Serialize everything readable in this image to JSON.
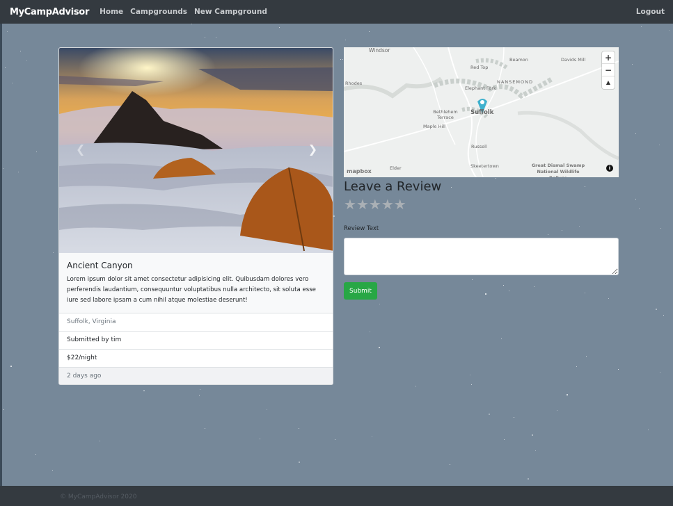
{
  "navbar": {
    "brand": "MyCampAdvisor",
    "links": [
      "Home",
      "Campgrounds",
      "New Campground"
    ],
    "logout": "Logout"
  },
  "campground": {
    "title": "Ancient Canyon",
    "description": "Lorem ipsum dolor sit amet consectetur adipisicing elit. Quibusdam dolores vero perferendis laudantium, consequuntur voluptatibus nulla architecto, sit soluta esse iure sed labore ipsam a cum nihil atque molestiae deserunt!",
    "location": "Suffolk, Virginia",
    "submitted_by": "Submitted by tim",
    "price": "$22/night",
    "posted": "2 days ago"
  },
  "carousel": {
    "prev_icon": "chevron-left-icon",
    "next_icon": "chevron-right-icon"
  },
  "map": {
    "labels": [
      "Windsor",
      "Beamon",
      "Davids Mill",
      "Red Top",
      "NANSEMOND",
      "Rhodes",
      "Elephant Fork",
      "Bethlehem Terrace",
      "Suffolk",
      "Maple Hill",
      "Russell",
      "Elder",
      "Skeetertown",
      "Great Dismal Swamp National Wildlife Refuge"
    ],
    "zoom_in": "+",
    "zoom_out": "−",
    "compass": "▲",
    "logo": "mapbox",
    "info": "i",
    "marker_color": "#3fb1ce"
  },
  "review": {
    "heading": "Leave a Review",
    "rating_stars": "★★★★★",
    "rating_value": 0,
    "label": "Review Text",
    "text_value": "",
    "submit": "Submit"
  },
  "footer": {
    "copyright": "© MyCampAdvisor 2020"
  },
  "colors": {
    "navbar": "#343a40",
    "background": "#768899",
    "submit": "#28a745"
  }
}
